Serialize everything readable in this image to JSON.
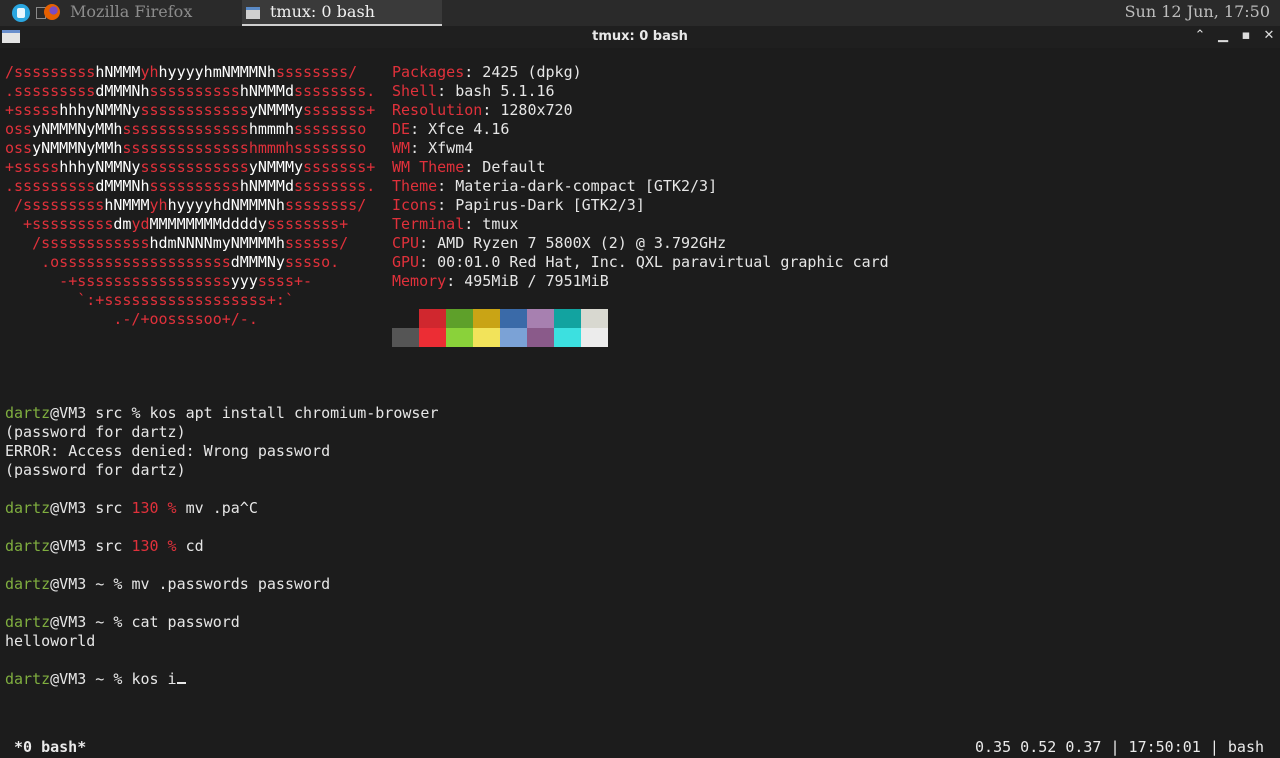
{
  "panel": {
    "tasks": [
      {
        "label": "Mozilla Firefox",
        "active": false
      },
      {
        "label": "tmux: 0 bash",
        "active": true
      }
    ],
    "clock": "Sun 12 Jun, 17:50"
  },
  "window": {
    "title": "tmux: 0 bash"
  },
  "logo": {
    "lines": [
      [
        [
          "r",
          "/sssssssss"
        ],
        [
          "w",
          "hNMMM"
        ],
        [
          "r",
          "yh"
        ],
        [
          "w",
          "hyyyyhmNMMMNh"
        ],
        [
          "r",
          "ssssssss/"
        ]
      ],
      [
        [
          "r",
          ".sssssssss"
        ],
        [
          "w",
          "dMMMNh"
        ],
        [
          "r",
          "ssssssssss"
        ],
        [
          "w",
          "hNMMMd"
        ],
        [
          "r",
          "ssssssss."
        ]
      ],
      [
        [
          "r",
          "+sssss"
        ],
        [
          "w",
          "hhhyNMMNy"
        ],
        [
          "r",
          "ssssssssssss"
        ],
        [
          "w",
          "yNMMMy"
        ],
        [
          "r",
          "sssssss+"
        ]
      ],
      [
        [
          "r",
          "oss"
        ],
        [
          "w",
          "yNMMMNyMMh"
        ],
        [
          "r",
          "ssssssssssssss"
        ],
        [
          "w",
          "hmmmh"
        ],
        [
          "r",
          "ssssssso"
        ]
      ],
      [
        [
          "r",
          "oss"
        ],
        [
          "w",
          "yNMMMNyMMh"
        ],
        [
          "r",
          "sssssssssssssshmmmh"
        ],
        [
          "r",
          "ssssssso"
        ]
      ],
      [
        [
          "r",
          "+sssss"
        ],
        [
          "w",
          "hhhyNMMNy"
        ],
        [
          "r",
          "ssssssssssss"
        ],
        [
          "w",
          "yNMMMy"
        ],
        [
          "r",
          "sssssss+"
        ]
      ],
      [
        [
          "r",
          ".sssssssss"
        ],
        [
          "w",
          "dMMMNh"
        ],
        [
          "r",
          "ssssssssss"
        ],
        [
          "w",
          "hNMMMd"
        ],
        [
          "r",
          "ssssssss."
        ]
      ],
      [
        [
          "r",
          " /sssssssss"
        ],
        [
          "w",
          "hNMMM"
        ],
        [
          "r",
          "yh"
        ],
        [
          "w",
          "hyyyyhdNMMMNh"
        ],
        [
          "r",
          "ssssssss/"
        ]
      ],
      [
        [
          "r",
          "  +sssssssss"
        ],
        [
          "w",
          "dm"
        ],
        [
          "r",
          "yd"
        ],
        [
          "w",
          "MMMMMMMMddddy"
        ],
        [
          "r",
          "ssssssss+"
        ]
      ],
      [
        [
          "r",
          "   /ssssssssssss"
        ],
        [
          "w",
          "hdmNNNNmyNMMMMh"
        ],
        [
          "r",
          "ssssss/"
        ]
      ],
      [
        [
          "r",
          "    .osssssssssssssssssss"
        ],
        [
          "w",
          "dMMMNy"
        ],
        [
          "r",
          "sssso."
        ]
      ],
      [
        [
          "r",
          "      -+sssssssssssssssss"
        ],
        [
          "w",
          "yyy"
        ],
        [
          "r",
          "ssss+-"
        ]
      ],
      [
        [
          "r",
          "        `:+ssssssssssssssssss+:`"
        ]
      ],
      [
        [
          "r",
          "            .-/+oossssoo+/-."
        ]
      ]
    ]
  },
  "sysinfo": [
    {
      "label": "Packages",
      "value": "2425 (dpkg)"
    },
    {
      "label": "Shell",
      "value": "bash 5.1.16"
    },
    {
      "label": "Resolution",
      "value": "1280x720"
    },
    {
      "label": "DE",
      "value": "Xfce 4.16"
    },
    {
      "label": "WM",
      "value": "Xfwm4"
    },
    {
      "label": "WM Theme",
      "value": "Default"
    },
    {
      "label": "Theme",
      "value": "Materia-dark-compact [GTK2/3]"
    },
    {
      "label": "Icons",
      "value": "Papirus-Dark [GTK2/3]"
    },
    {
      "label": "Terminal",
      "value": "tmux"
    },
    {
      "label": "CPU",
      "value": "AMD Ryzen 7 5800X (2) @ 3.792GHz"
    },
    {
      "label": "GPU",
      "value": "00:01.0 Red Hat, Inc. QXL paravirtual graphic card"
    },
    {
      "label": "Memory",
      "value": "495MiB / 7951MiB"
    }
  ],
  "palette": {
    "top": [
      "#1c1c1c",
      "#d0272e",
      "#5ea02a",
      "#c9a415",
      "#3a6aa8",
      "#a780b0",
      "#12a3a0",
      "#d8d8d0"
    ],
    "bottom": [
      "#555555",
      "#ec2d34",
      "#8ad23a",
      "#f2e35a",
      "#7ba2d6",
      "#8a5a8a",
      "#3ce0e0",
      "#ececec"
    ]
  },
  "prompt": {
    "user": "dartz",
    "at": "@VM3"
  },
  "session": [
    {
      "type": "cmd",
      "dir": "src",
      "code": "",
      "cmd": "kos apt install chromium-browser"
    },
    {
      "type": "out",
      "text": "(password for dartz)"
    },
    {
      "type": "out",
      "text": "ERROR: Access denied: Wrong password"
    },
    {
      "type": "out",
      "text": "(password for dartz)"
    },
    {
      "type": "blank"
    },
    {
      "type": "cmd",
      "dir": "src",
      "code": "130",
      "cmd": "mv .pa^C"
    },
    {
      "type": "blank"
    },
    {
      "type": "cmd",
      "dir": "src",
      "code": "130",
      "cmd": "cd"
    },
    {
      "type": "blank"
    },
    {
      "type": "cmd",
      "dir": "~",
      "code": "",
      "cmd": "mv .passwords password"
    },
    {
      "type": "blank"
    },
    {
      "type": "cmd",
      "dir": "~",
      "code": "",
      "cmd": "cat password"
    },
    {
      "type": "out",
      "text": "helloworld"
    },
    {
      "type": "blank"
    },
    {
      "type": "cmd",
      "dir": "~",
      "code": "",
      "cmd": "kos i",
      "cursor": true
    }
  ],
  "statusbar": {
    "window": "*0 bash*",
    "right": "0.35 0.52 0.37 | 17:50:01 | bash"
  }
}
